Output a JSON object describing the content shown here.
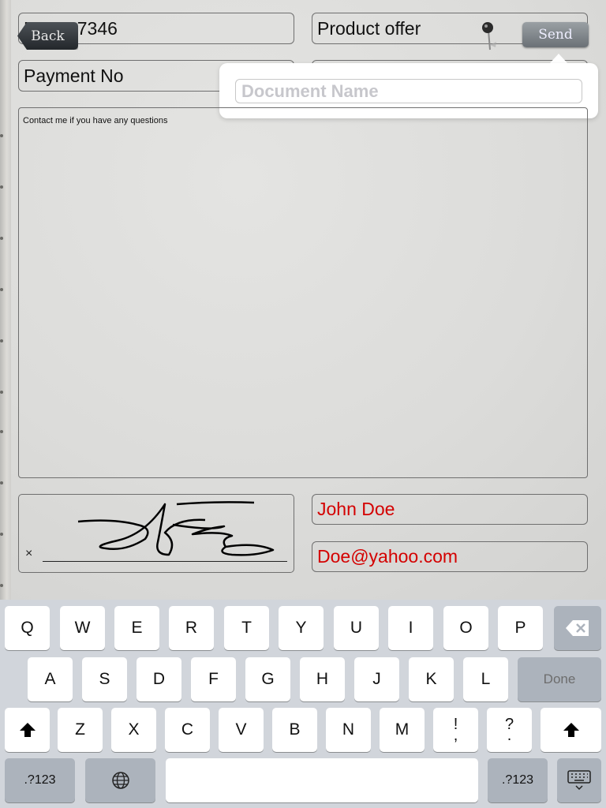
{
  "nav": {
    "back_label": "Back",
    "send_label": "Send"
  },
  "form": {
    "doc_number": "Demo 7346",
    "subject": "Product offer",
    "payment_label": "Payment No",
    "message": "Contact me if you have any questions",
    "name": "John Doe",
    "email": "Doe@yahoo.com",
    "signature_mark": "×"
  },
  "popover": {
    "placeholder": "Document Name"
  },
  "colors": {
    "entered_text": "#d40000",
    "placeholder": "#c7c7cc",
    "keyboard_bg": "#d1d5db"
  },
  "keyboard": {
    "row1": [
      "Q",
      "W",
      "E",
      "R",
      "T",
      "Y",
      "U",
      "I",
      "O",
      "P"
    ],
    "row2": [
      "A",
      "S",
      "D",
      "F",
      "G",
      "H",
      "J",
      "K",
      "L"
    ],
    "row3": [
      "Z",
      "X",
      "C",
      "V",
      "B",
      "N",
      "M"
    ],
    "punct1": [
      "!",
      ","
    ],
    "punct2": [
      "?",
      "."
    ],
    "done_label": "Done",
    "numbers_label": ".?123",
    "icons": [
      "backspace-icon",
      "shift-icon",
      "globe-icon",
      "keyboard-hide-icon"
    ]
  }
}
